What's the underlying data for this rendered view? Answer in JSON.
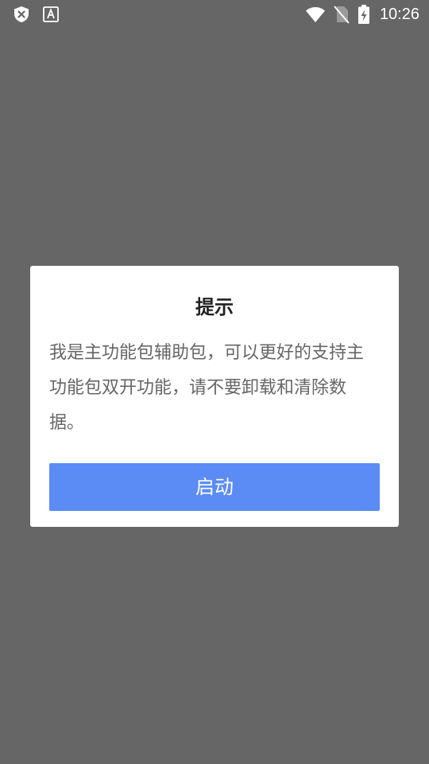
{
  "status_bar": {
    "time": "10:26",
    "icons": [
      "security-shield-icon",
      "text-a-icon",
      "wifi-icon",
      "no-sim-icon",
      "battery-charging-icon"
    ]
  },
  "dialog": {
    "title": "提示",
    "message": "我是主功能包辅助包，可以更好的支持主功能包双开功能，请不要卸载和清除数据。",
    "button_label": "启动"
  },
  "colors": {
    "overlay": "#666666",
    "dialog_background": "#ffffff",
    "button": "#5b8bf5",
    "title_text": "#222222",
    "message_text": "#666666"
  }
}
